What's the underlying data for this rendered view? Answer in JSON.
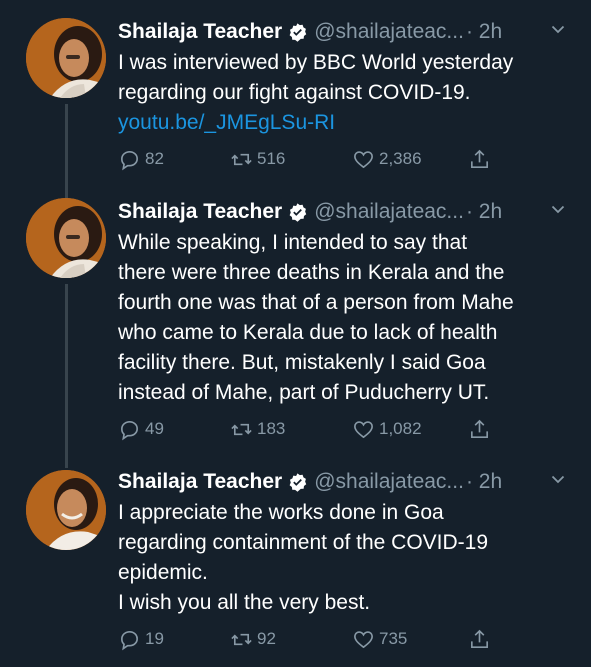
{
  "tweets": [
    {
      "name": "Shailaja Teacher",
      "handle": "@shailajateac...",
      "time": "· 2h",
      "lines": [
        "I was interviewed by BBC World yesterday",
        "regarding our fight against COVID-19."
      ],
      "link": "youtu.be/_JMEgLSu-RI",
      "replies": "82",
      "retweets": "516",
      "likes": "2,386"
    },
    {
      "name": "Shailaja Teacher",
      "handle": "@shailajateac...",
      "time": "· 2h",
      "lines": [
        "While speaking, I intended to say that",
        "there were three deaths in Kerala and the",
        "fourth one was that of a person from Mahe",
        "who came to Kerala due to lack of health",
        "facility there. But, mistakenly I said Goa",
        "instead of Mahe, part of Puducherry UT."
      ],
      "replies": "49",
      "retweets": "183",
      "likes": "1,082"
    },
    {
      "name": "Shailaja Teacher",
      "handle": "@shailajateac...",
      "time": "· 2h",
      "lines": [
        "I appreciate the works done in Goa",
        "regarding containment of the COVID-19",
        "epidemic.",
        "I wish you all the very best."
      ],
      "replies": "19",
      "retweets": "92",
      "likes": "735"
    }
  ],
  "colors": {
    "background": "#15202b",
    "secondary_text": "#8899a6",
    "link": "#1b95e0",
    "verified": "#ffffff"
  },
  "icons": [
    "verified-icon",
    "chevron-down-icon",
    "reply-icon",
    "retweet-icon",
    "like-icon",
    "share-icon"
  ]
}
